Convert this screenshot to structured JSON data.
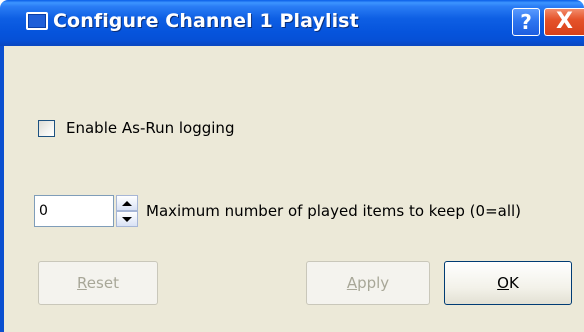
{
  "window": {
    "title": "Configure Channel 1 Playlist",
    "help_label": "?",
    "close_label": "X",
    "icon": "window-icon"
  },
  "options": {
    "asrun_label": "Enable As-Run logging",
    "asrun_checked": false,
    "max_items_value": "0",
    "max_items_label": "Maximum number of played items to keep (0=all)"
  },
  "buttons": {
    "reset": {
      "mnemonic": "R",
      "rest": "eset",
      "enabled": false
    },
    "apply": {
      "mnemonic": "A",
      "rest": "pply",
      "enabled": false
    },
    "ok": {
      "mnemonic": "O",
      "rest": "K",
      "enabled": true
    }
  },
  "colors": {
    "titlebar": "#0654dc",
    "dialog_bg": "#ece9d8",
    "close_button": "#e5532a",
    "disabled_text": "#a8a798"
  }
}
